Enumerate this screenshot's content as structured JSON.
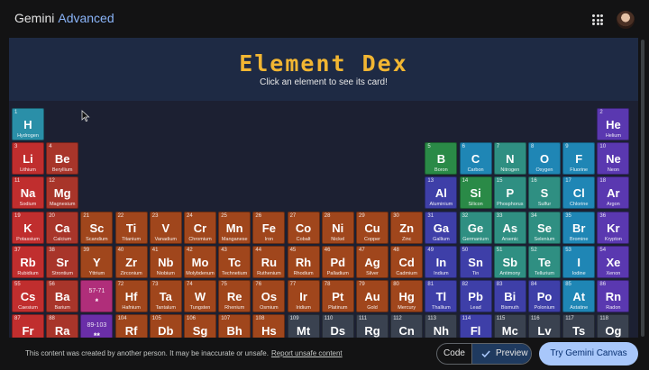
{
  "app": {
    "name": "Gemini",
    "tier": "Advanced"
  },
  "header": {
    "apps_icon": "apps-grid-icon",
    "avatar": "user-avatar"
  },
  "canvas": {
    "title": "Element Dex",
    "subtitle": "Click an element to see its card!"
  },
  "colors": {
    "nonmetal": "#2a8a47",
    "noble": "#5a38b0",
    "alkali": "#c02e2e",
    "alkaline": "#a8352a",
    "transition": "#a0461c",
    "post": "#3e3fa8",
    "metalloid": "#2f8f82",
    "halogen": "#1f86b5",
    "lanth": "#b02e7a",
    "actin": "#6a2ea8",
    "unknown": "#3a4250",
    "hydrogen": "#2a8fa8"
  },
  "elements": [
    {
      "n": "1",
      "s": "H",
      "name": "Hydrogen",
      "c": 0,
      "r": 0,
      "cat": "hydrogen"
    },
    {
      "n": "2",
      "s": "He",
      "name": "Helium",
      "c": 17,
      "r": 0,
      "cat": "noble"
    },
    {
      "n": "3",
      "s": "Li",
      "name": "Lithium",
      "c": 0,
      "r": 1,
      "cat": "alkali"
    },
    {
      "n": "4",
      "s": "Be",
      "name": "Beryllium",
      "c": 1,
      "r": 1,
      "cat": "alkaline"
    },
    {
      "n": "5",
      "s": "B",
      "name": "Boron",
      "c": 12,
      "r": 1,
      "cat": "nonmetal"
    },
    {
      "n": "6",
      "s": "C",
      "name": "Carbon",
      "c": 13,
      "r": 1,
      "cat": "halogen"
    },
    {
      "n": "7",
      "s": "N",
      "name": "Nitrogen",
      "c": 14,
      "r": 1,
      "cat": "metalloid"
    },
    {
      "n": "8",
      "s": "O",
      "name": "Oxygen",
      "c": 15,
      "r": 1,
      "cat": "halogen"
    },
    {
      "n": "9",
      "s": "F",
      "name": "Fluorine",
      "c": 16,
      "r": 1,
      "cat": "halogen"
    },
    {
      "n": "10",
      "s": "Ne",
      "name": "Neon",
      "c": 17,
      "r": 1,
      "cat": "noble"
    },
    {
      "n": "11",
      "s": "Na",
      "name": "Sodium",
      "c": 0,
      "r": 2,
      "cat": "alkali"
    },
    {
      "n": "12",
      "s": "Mg",
      "name": "Magnesium",
      "c": 1,
      "r": 2,
      "cat": "alkaline"
    },
    {
      "n": "13",
      "s": "Al",
      "name": "Aluminium",
      "c": 12,
      "r": 2,
      "cat": "post"
    },
    {
      "n": "14",
      "s": "Si",
      "name": "Silicon",
      "c": 13,
      "r": 2,
      "cat": "nonmetal"
    },
    {
      "n": "15",
      "s": "P",
      "name": "Phosphorus",
      "c": 14,
      "r": 2,
      "cat": "metalloid"
    },
    {
      "n": "16",
      "s": "S",
      "name": "Sulfur",
      "c": 15,
      "r": 2,
      "cat": "metalloid"
    },
    {
      "n": "17",
      "s": "Cl",
      "name": "Chlorine",
      "c": 16,
      "r": 2,
      "cat": "halogen"
    },
    {
      "n": "18",
      "s": "Ar",
      "name": "Argon",
      "c": 17,
      "r": 2,
      "cat": "noble"
    },
    {
      "n": "19",
      "s": "K",
      "name": "Potassium",
      "c": 0,
      "r": 3,
      "cat": "alkali"
    },
    {
      "n": "20",
      "s": "Ca",
      "name": "Calcium",
      "c": 1,
      "r": 3,
      "cat": "alkaline"
    },
    {
      "n": "21",
      "s": "Sc",
      "name": "Scandium",
      "c": 2,
      "r": 3,
      "cat": "transition"
    },
    {
      "n": "22",
      "s": "Ti",
      "name": "Titanium",
      "c": 3,
      "r": 3,
      "cat": "transition"
    },
    {
      "n": "23",
      "s": "V",
      "name": "Vanadium",
      "c": 4,
      "r": 3,
      "cat": "transition"
    },
    {
      "n": "24",
      "s": "Cr",
      "name": "Chromium",
      "c": 5,
      "r": 3,
      "cat": "transition"
    },
    {
      "n": "25",
      "s": "Mn",
      "name": "Manganese",
      "c": 6,
      "r": 3,
      "cat": "transition"
    },
    {
      "n": "26",
      "s": "Fe",
      "name": "Iron",
      "c": 7,
      "r": 3,
      "cat": "transition"
    },
    {
      "n": "27",
      "s": "Co",
      "name": "Cobalt",
      "c": 8,
      "r": 3,
      "cat": "transition"
    },
    {
      "n": "28",
      "s": "Ni",
      "name": "Nickel",
      "c": 9,
      "r": 3,
      "cat": "transition"
    },
    {
      "n": "29",
      "s": "Cu",
      "name": "Copper",
      "c": 10,
      "r": 3,
      "cat": "transition"
    },
    {
      "n": "30",
      "s": "Zn",
      "name": "Zinc",
      "c": 11,
      "r": 3,
      "cat": "transition"
    },
    {
      "n": "31",
      "s": "Ga",
      "name": "Gallium",
      "c": 12,
      "r": 3,
      "cat": "post"
    },
    {
      "n": "32",
      "s": "Ge",
      "name": "Germanium",
      "c": 13,
      "r": 3,
      "cat": "metalloid"
    },
    {
      "n": "33",
      "s": "As",
      "name": "Arsenic",
      "c": 14,
      "r": 3,
      "cat": "metalloid"
    },
    {
      "n": "34",
      "s": "Se",
      "name": "Selenium",
      "c": 15,
      "r": 3,
      "cat": "metalloid"
    },
    {
      "n": "35",
      "s": "Br",
      "name": "Bromine",
      "c": 16,
      "r": 3,
      "cat": "halogen"
    },
    {
      "n": "36",
      "s": "Kr",
      "name": "Krypton",
      "c": 17,
      "r": 3,
      "cat": "noble"
    },
    {
      "n": "37",
      "s": "Rb",
      "name": "Rubidium",
      "c": 0,
      "r": 4,
      "cat": "alkali"
    },
    {
      "n": "38",
      "s": "Sr",
      "name": "Strontium",
      "c": 1,
      "r": 4,
      "cat": "alkaline"
    },
    {
      "n": "39",
      "s": "Y",
      "name": "Yttrium",
      "c": 2,
      "r": 4,
      "cat": "transition"
    },
    {
      "n": "40",
      "s": "Zr",
      "name": "Zirconium",
      "c": 3,
      "r": 4,
      "cat": "transition"
    },
    {
      "n": "41",
      "s": "Nb",
      "name": "Niobium",
      "c": 4,
      "r": 4,
      "cat": "transition"
    },
    {
      "n": "42",
      "s": "Mo",
      "name": "Molybdenum",
      "c": 5,
      "r": 4,
      "cat": "transition"
    },
    {
      "n": "43",
      "s": "Tc",
      "name": "Technetium",
      "c": 6,
      "r": 4,
      "cat": "transition"
    },
    {
      "n": "44",
      "s": "Ru",
      "name": "Ruthenium",
      "c": 7,
      "r": 4,
      "cat": "transition"
    },
    {
      "n": "45",
      "s": "Rh",
      "name": "Rhodium",
      "c": 8,
      "r": 4,
      "cat": "transition"
    },
    {
      "n": "46",
      "s": "Pd",
      "name": "Palladium",
      "c": 9,
      "r": 4,
      "cat": "transition"
    },
    {
      "n": "47",
      "s": "Ag",
      "name": "Silver",
      "c": 10,
      "r": 4,
      "cat": "transition"
    },
    {
      "n": "48",
      "s": "Cd",
      "name": "Cadmium",
      "c": 11,
      "r": 4,
      "cat": "transition"
    },
    {
      "n": "49",
      "s": "In",
      "name": "Indium",
      "c": 12,
      "r": 4,
      "cat": "post"
    },
    {
      "n": "50",
      "s": "Sn",
      "name": "Tin",
      "c": 13,
      "r": 4,
      "cat": "post"
    },
    {
      "n": "51",
      "s": "Sb",
      "name": "Antimony",
      "c": 14,
      "r": 4,
      "cat": "metalloid"
    },
    {
      "n": "52",
      "s": "Te",
      "name": "Tellurium",
      "c": 15,
      "r": 4,
      "cat": "metalloid"
    },
    {
      "n": "53",
      "s": "I",
      "name": "Iodine",
      "c": 16,
      "r": 4,
      "cat": "halogen"
    },
    {
      "n": "54",
      "s": "Xe",
      "name": "Xenon",
      "c": 17,
      "r": 4,
      "cat": "noble"
    },
    {
      "n": "55",
      "s": "Cs",
      "name": "Caesium",
      "c": 0,
      "r": 5,
      "cat": "alkali"
    },
    {
      "n": "56",
      "s": "Ba",
      "name": "Barium",
      "c": 1,
      "r": 5,
      "cat": "alkaline"
    },
    {
      "n": "57-71",
      "s": "*",
      "name": "",
      "c": 2,
      "r": 5,
      "cat": "lanth"
    },
    {
      "n": "72",
      "s": "Hf",
      "name": "Hafnium",
      "c": 3,
      "r": 5,
      "cat": "transition"
    },
    {
      "n": "73",
      "s": "Ta",
      "name": "Tantalum",
      "c": 4,
      "r": 5,
      "cat": "transition"
    },
    {
      "n": "74",
      "s": "W",
      "name": "Tungsten",
      "c": 5,
      "r": 5,
      "cat": "transition"
    },
    {
      "n": "75",
      "s": "Re",
      "name": "Rhenium",
      "c": 6,
      "r": 5,
      "cat": "transition"
    },
    {
      "n": "76",
      "s": "Os",
      "name": "Osmium",
      "c": 7,
      "r": 5,
      "cat": "transition"
    },
    {
      "n": "77",
      "s": "Ir",
      "name": "Iridium",
      "c": 8,
      "r": 5,
      "cat": "transition"
    },
    {
      "n": "78",
      "s": "Pt",
      "name": "Platinum",
      "c": 9,
      "r": 5,
      "cat": "transition"
    },
    {
      "n": "79",
      "s": "Au",
      "name": "Gold",
      "c": 10,
      "r": 5,
      "cat": "transition"
    },
    {
      "n": "80",
      "s": "Hg",
      "name": "Mercury",
      "c": 11,
      "r": 5,
      "cat": "transition"
    },
    {
      "n": "81",
      "s": "Tl",
      "name": "Thallium",
      "c": 12,
      "r": 5,
      "cat": "post"
    },
    {
      "n": "82",
      "s": "Pb",
      "name": "Lead",
      "c": 13,
      "r": 5,
      "cat": "post"
    },
    {
      "n": "83",
      "s": "Bi",
      "name": "Bismuth",
      "c": 14,
      "r": 5,
      "cat": "post"
    },
    {
      "n": "84",
      "s": "Po",
      "name": "Polonium",
      "c": 15,
      "r": 5,
      "cat": "post"
    },
    {
      "n": "85",
      "s": "At",
      "name": "Astatine",
      "c": 16,
      "r": 5,
      "cat": "halogen"
    },
    {
      "n": "86",
      "s": "Rn",
      "name": "Radon",
      "c": 17,
      "r": 5,
      "cat": "noble"
    },
    {
      "n": "87",
      "s": "Fr",
      "name": "Francium",
      "c": 0,
      "r": 6,
      "cat": "alkali"
    },
    {
      "n": "88",
      "s": "Ra",
      "name": "Radium",
      "c": 1,
      "r": 6,
      "cat": "alkaline"
    },
    {
      "n": "89-103",
      "s": "**",
      "name": "",
      "c": 2,
      "r": 6,
      "cat": "actin"
    },
    {
      "n": "104",
      "s": "Rf",
      "name": "Rutherfordium",
      "c": 3,
      "r": 6,
      "cat": "transition"
    },
    {
      "n": "105",
      "s": "Db",
      "name": "Dubnium",
      "c": 4,
      "r": 6,
      "cat": "transition"
    },
    {
      "n": "106",
      "s": "Sg",
      "name": "Seaborgium",
      "c": 5,
      "r": 6,
      "cat": "transition"
    },
    {
      "n": "107",
      "s": "Bh",
      "name": "Bohrium",
      "c": 6,
      "r": 6,
      "cat": "transition"
    },
    {
      "n": "108",
      "s": "Hs",
      "name": "Hassium",
      "c": 7,
      "r": 6,
      "cat": "transition"
    },
    {
      "n": "109",
      "s": "Mt",
      "name": "Meitnerium",
      "c": 8,
      "r": 6,
      "cat": "unknown"
    },
    {
      "n": "110",
      "s": "Ds",
      "name": "Darmstadtium",
      "c": 9,
      "r": 6,
      "cat": "unknown"
    },
    {
      "n": "111",
      "s": "Rg",
      "name": "Roentgenium",
      "c": 10,
      "r": 6,
      "cat": "unknown"
    },
    {
      "n": "112",
      "s": "Cn",
      "name": "Copernicium",
      "c": 11,
      "r": 6,
      "cat": "unknown"
    },
    {
      "n": "113",
      "s": "Nh",
      "name": "Nihonium",
      "c": 12,
      "r": 6,
      "cat": "unknown"
    },
    {
      "n": "114",
      "s": "Fl",
      "name": "Flerovium",
      "c": 13,
      "r": 6,
      "cat": "post"
    },
    {
      "n": "115",
      "s": "Mc",
      "name": "Moscovium",
      "c": 14,
      "r": 6,
      "cat": "unknown"
    },
    {
      "n": "116",
      "s": "Lv",
      "name": "Livermorium",
      "c": 15,
      "r": 6,
      "cat": "unknown"
    },
    {
      "n": "117",
      "s": "Ts",
      "name": "Tennessine",
      "c": 16,
      "r": 6,
      "cat": "unknown"
    },
    {
      "n": "118",
      "s": "Og",
      "name": "Oganesson",
      "c": 17,
      "r": 6,
      "cat": "unknown"
    }
  ],
  "footer": {
    "disclaimer": "This content was created by another person. It may be inaccurate or unsafe.",
    "report_link": "Report unsafe content",
    "code_label": "Code",
    "preview_label": "Preview",
    "try_label": "Try Gemini Canvas"
  }
}
